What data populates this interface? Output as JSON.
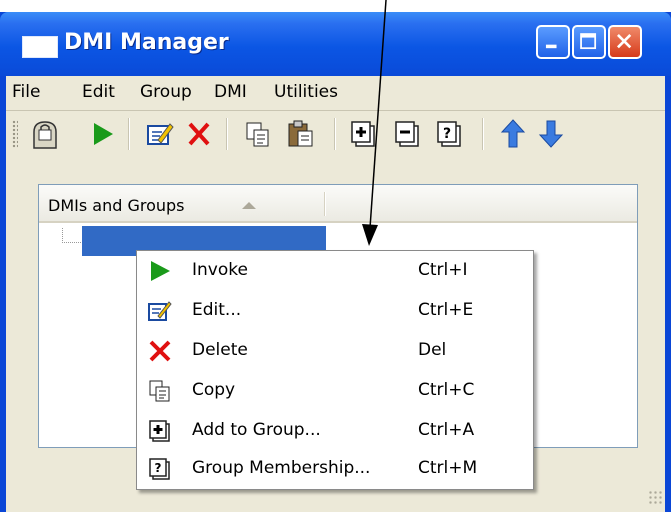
{
  "window": {
    "title": "DMI Manager",
    "icons": {
      "app": "window-icon",
      "minimize": "minimize-icon",
      "maximize": "maximize-icon",
      "close": "close-icon"
    }
  },
  "menubar": {
    "items": [
      {
        "label": "File"
      },
      {
        "label": "Edit"
      },
      {
        "label": "Group"
      },
      {
        "label": "DMI"
      },
      {
        "label": "Utilities"
      }
    ]
  },
  "toolbar": {
    "icons": [
      "properties-icon",
      "invoke-icon",
      "edit-icon",
      "delete-icon",
      "copy-icon",
      "paste-icon",
      "add-to-group-icon",
      "remove-from-group-icon",
      "group-membership-icon",
      "move-up-icon",
      "move-down-icon"
    ]
  },
  "list": {
    "column_header": "DMIs and Groups",
    "sort_indicator": "sort-ascending-icon"
  },
  "context_menu": {
    "items": [
      {
        "label": "Invoke",
        "shortcut": "Ctrl+I",
        "icon": "invoke-icon"
      },
      {
        "label": "Edit...",
        "shortcut": "Ctrl+E",
        "icon": "edit-icon"
      },
      {
        "label": "Delete",
        "shortcut": "Del",
        "icon": "delete-icon"
      },
      {
        "label": "Copy",
        "shortcut": "Ctrl+C",
        "icon": "copy-icon"
      },
      {
        "label": "Add to Group...",
        "shortcut": "Ctrl+A",
        "icon": "add-to-group-icon"
      },
      {
        "label": "Group Membership...",
        "shortcut": "Ctrl+M",
        "icon": "group-membership-icon"
      }
    ]
  },
  "colors": {
    "titlebar": "#0a4ad8",
    "selection": "#316ac5",
    "face": "#ece9d8",
    "invoke_green": "#1a9a1a",
    "delete_red": "#e01010",
    "arrow_blue": "#3a7be0"
  }
}
